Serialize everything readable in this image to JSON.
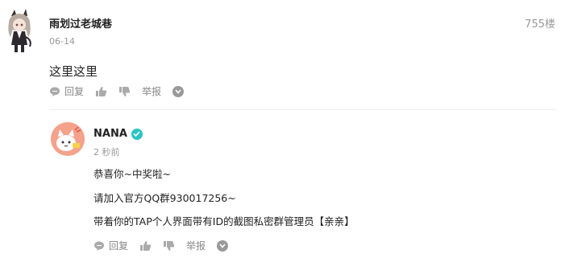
{
  "reply_main": {
    "username": "雨划过老城巷",
    "date": "06-14",
    "floor": "755楼",
    "content": "这里这里",
    "actions": {
      "reply": "回复",
      "report": "举报"
    }
  },
  "reply_nested": {
    "username": "NANA",
    "verified": true,
    "time": "2 秒前",
    "lines": [
      "恭喜你~中奖啦~",
      "请加入官方QQ群930017256~",
      "带着你的TAP个人界面带有ID的截图私密群管理员【亲亲】"
    ],
    "actions": {
      "reply": "回复",
      "report": "举报"
    }
  },
  "colors": {
    "accent_verified": "#2bc3c3",
    "muted": "#999999",
    "text": "#222222"
  }
}
